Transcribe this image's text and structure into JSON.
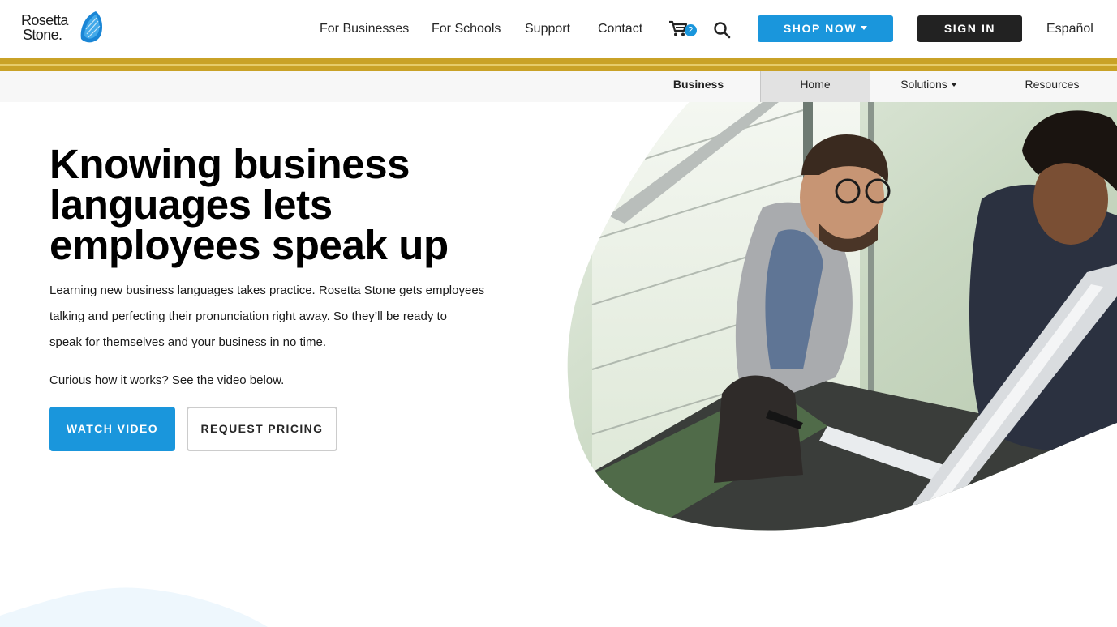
{
  "header": {
    "logo": {
      "line1": "Rosetta",
      "line2": "Stone."
    },
    "nav": [
      "For Businesses",
      "For Schools",
      "Support",
      "Contact"
    ],
    "cart_count": "2",
    "shop_now": "SHOP NOW",
    "sign_in": "SIGN IN",
    "language": "Español"
  },
  "subnav": {
    "section": "Business",
    "items": [
      "Home",
      "Solutions",
      "Resources"
    ],
    "active": "Home"
  },
  "hero": {
    "title_lines": [
      "Knowing business",
      "languages lets",
      "employees speak up"
    ],
    "body_lines": [
      "Learning new business languages takes practice. Rosetta Stone gets employees",
      "talking and perfecting their pronunciation right away. So they’ll be ready to",
      "speak for themselves and your business in no time."
    ],
    "curious": "Curious how it works? See the video below.",
    "watch_video": "WATCH VIDEO",
    "request_pricing": "REQUEST PRICING"
  },
  "colors": {
    "accent_blue": "#1a96dc",
    "gold_bar": "#c9a227",
    "dark_button": "#222222"
  },
  "icons": {
    "logo_mark": "blue-stone-logo-icon",
    "cart": "shopping-cart-icon",
    "search": "search-icon",
    "dropdown": "chevron-down-icon"
  }
}
